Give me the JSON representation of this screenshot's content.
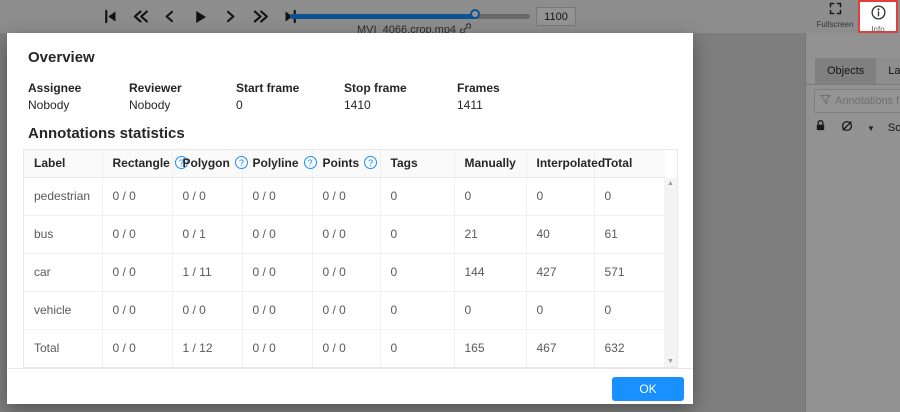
{
  "colors": {
    "accent": "#1890ff",
    "highlight_border": "#e0403c"
  },
  "icons": {
    "help_glyph": "?",
    "scroll_up": "▲",
    "scroll_down": "▼",
    "caret_down": "▼",
    "names": [
      "first-frame-icon",
      "backward-icon",
      "previous-frame-icon",
      "play-icon",
      "next-frame-icon",
      "forward-icon",
      "last-frame-icon",
      "fullscreen-icon",
      "info-icon",
      "filter-funnel-icon",
      "lock-icon",
      "eye-slash-icon",
      "link-icon"
    ]
  },
  "topbar": {
    "frame_value": "1100",
    "filename": "MVI_4066.crop.mp4",
    "fullscreen_label": "Fullscreen",
    "info_label": "Info"
  },
  "sidebar": {
    "tabs": {
      "objects": "Objects",
      "labels": "Labels"
    },
    "filter_placeholder": "Annotations filter",
    "sort_label": "Sort"
  },
  "modal": {
    "title": "Overview",
    "fields": [
      {
        "label": "Assignee",
        "value": "Nobody"
      },
      {
        "label": "Reviewer",
        "value": "Nobody"
      },
      {
        "label": "Start frame",
        "value": "0"
      },
      {
        "label": "Stop frame",
        "value": "1410"
      },
      {
        "label": "Frames",
        "value": "1411"
      }
    ],
    "stats_title": "Annotations statistics",
    "table": {
      "headers": [
        "Label",
        "Rectangle",
        "Polygon",
        "Polyline",
        "Points",
        "Tags",
        "Manually",
        "Interpolated",
        "Total"
      ],
      "rows": [
        {
          "cells": [
            "pedestrian",
            "0 / 0",
            "0 / 0",
            "0 / 0",
            "0 / 0",
            "0",
            "0",
            "0",
            "0"
          ]
        },
        {
          "cells": [
            "bus",
            "0 / 0",
            "0 / 1",
            "0 / 0",
            "0 / 0",
            "0",
            "21",
            "40",
            "61"
          ]
        },
        {
          "cells": [
            "car",
            "0 / 0",
            "1 / 11",
            "0 / 0",
            "0 / 0",
            "0",
            "144",
            "427",
            "571"
          ]
        },
        {
          "cells": [
            "vehicle",
            "0 / 0",
            "0 / 0",
            "0 / 0",
            "0 / 0",
            "0",
            "0",
            "0",
            "0"
          ]
        },
        {
          "cells": [
            "Total",
            "0 / 0",
            "1 / 12",
            "0 / 0",
            "0 / 0",
            "0",
            "165",
            "467",
            "632"
          ]
        }
      ]
    },
    "ok_label": "OK"
  }
}
